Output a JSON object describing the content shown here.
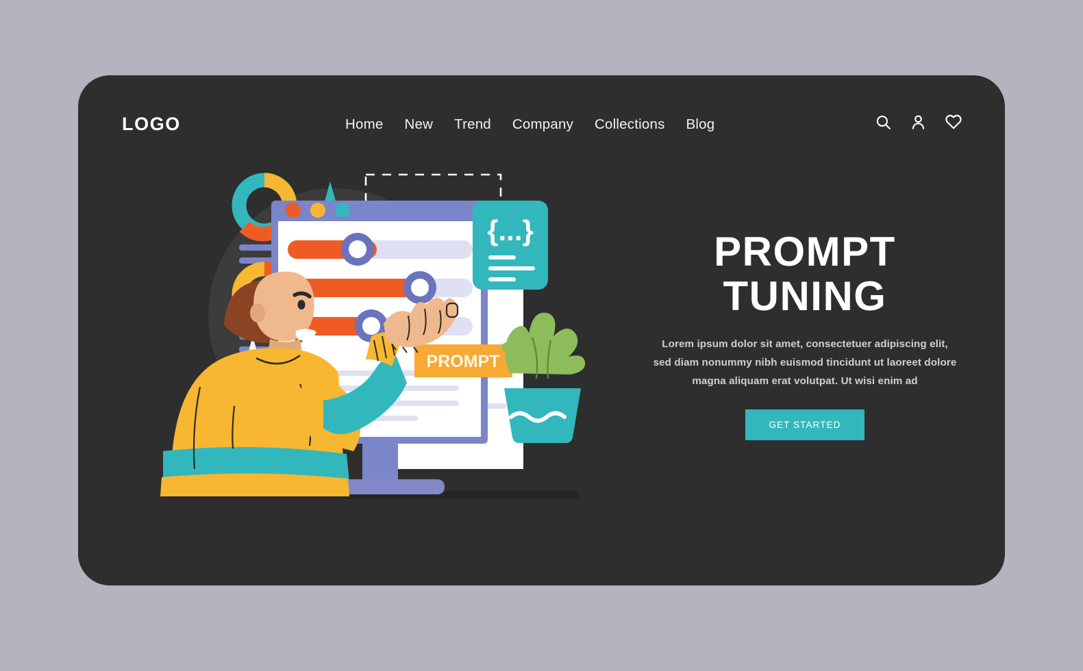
{
  "page": {
    "background_color": "#b3b4bd",
    "card_color": "#2e2e2e"
  },
  "header": {
    "logo": "LOGO",
    "nav": [
      {
        "label": "Home"
      },
      {
        "label": "New"
      },
      {
        "label": "Trend"
      },
      {
        "label": "Company"
      },
      {
        "label": "Collections"
      },
      {
        "label": "Blog"
      }
    ],
    "icons": [
      {
        "name": "search-icon"
      },
      {
        "name": "user-icon"
      },
      {
        "name": "heart-icon"
      }
    ]
  },
  "hero": {
    "headline_line1": "PROMPT",
    "headline_line2": "TUNING",
    "body": "Lorem ipsum dolor sit amet, consectetuer adipiscing elit, sed diam nonummy nibh euismod tincidunt ut laoreet dolore magna aliquam erat volutpat. Ut wisi enim ad",
    "cta_label": "GET STARTED"
  },
  "illustration": {
    "prompt_tag": "PROMPT",
    "code_badge": "{...}",
    "colors": {
      "teal": "#32b7bd",
      "orange": "#ef5b25",
      "yellow": "#f7b731",
      "periwinkle": "#7b85c9",
      "light_lavender": "#dfe0f2",
      "skin": "#f0b98d",
      "hair": "#8b4423",
      "plant_green": "#8fbc5a",
      "white": "#ffffff",
      "circle_backdrop": "#3c3c3c"
    },
    "sliders": [
      {
        "fill_percent": 48
      },
      {
        "fill_percent": 74
      },
      {
        "fill_percent": 42
      }
    ],
    "donut_charts": [
      {
        "segments": [
          "teal",
          "yellow",
          "orange"
        ]
      },
      {
        "segments": [
          "yellow",
          "orange",
          "teal"
        ]
      }
    ],
    "window_dots": [
      "#ef5b25",
      "#f7b731",
      "#32b7bd"
    ]
  }
}
